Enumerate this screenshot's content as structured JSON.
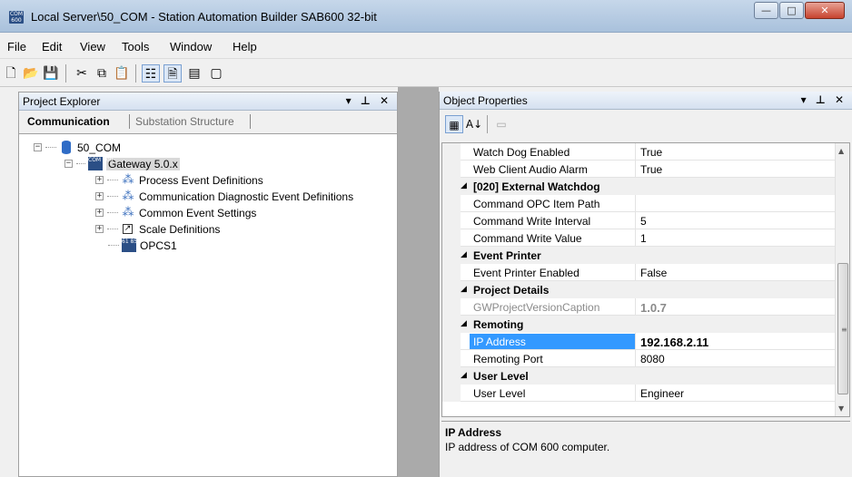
{
  "window": {
    "app_icon_text": "COM 600",
    "title": "Local Server\\50_COM - Station Automation Builder SAB600 32-bit",
    "minimize": "—",
    "maximize": "□",
    "close": "✕"
  },
  "menu": [
    "File",
    "Edit",
    "View",
    "Tools",
    "Window",
    "Help"
  ],
  "toolbar": [
    {
      "icon": "new-file-icon",
      "glyph": "🗋"
    },
    {
      "icon": "open-folder-icon",
      "glyph": "📂"
    },
    {
      "icon": "save-icon",
      "glyph": "💾"
    },
    {
      "icon": "cut-icon",
      "glyph": "✂"
    },
    {
      "icon": "copy-icon",
      "glyph": "⧉"
    },
    {
      "icon": "paste-icon",
      "glyph": "📋"
    },
    {
      "icon": "project-explorer-icon",
      "glyph": "☷"
    },
    {
      "icon": "properties-icon",
      "glyph": "🗎"
    },
    {
      "icon": "output-window-icon",
      "glyph": "▤"
    },
    {
      "icon": "window-icon",
      "glyph": "▢"
    }
  ],
  "project_explorer": {
    "title": "Project Explorer",
    "controls": "▾ ⊥ ✕",
    "tabs": {
      "active": "Communication",
      "inactive": "Substation Structure"
    },
    "tree": {
      "root": {
        "label": "50_COM",
        "expander": "−"
      },
      "gateway": {
        "label": "Gateway 5.0.x",
        "expander": "−",
        "icon_text": "COM 600"
      },
      "children": [
        {
          "label": "Process Event Definitions",
          "expander": "+",
          "icon": "event-definitions-icon"
        },
        {
          "label": "Communication Diagnostic Event Definitions",
          "expander": "+",
          "icon": "event-definitions-icon"
        },
        {
          "label": "Common Event Settings",
          "expander": "+",
          "icon": "event-definitions-icon"
        },
        {
          "label": "Scale Definitions",
          "expander": "+",
          "icon": "scale-icon"
        },
        {
          "label": "OPCS1",
          "expander": "",
          "icon": "opc-server-icon",
          "icon_text": "61 850"
        }
      ]
    }
  },
  "object_properties": {
    "title": "Object Properties",
    "controls": "▾ ⊥ ✕",
    "toolbar": [
      {
        "icon": "categorized-icon",
        "glyph": "▦"
      },
      {
        "icon": "alphabetical-sort-icon",
        "glyph": "A↓"
      },
      {
        "icon": "property-pages-icon",
        "glyph": "▭"
      }
    ],
    "rows": [
      {
        "type": "prop",
        "name": "Watch Dog Enabled",
        "value": "True"
      },
      {
        "type": "prop",
        "name": "Web Client Audio Alarm",
        "value": "True"
      },
      {
        "type": "cat",
        "name": "[020] External Watchdog"
      },
      {
        "type": "prop",
        "name": "Command OPC Item Path",
        "value": ""
      },
      {
        "type": "prop",
        "name": "Command Write Interval",
        "value": "5"
      },
      {
        "type": "prop",
        "name": "Command Write Value",
        "value": "1"
      },
      {
        "type": "cat",
        "name": "Event Printer"
      },
      {
        "type": "prop",
        "name": "Event Printer Enabled",
        "value": "False"
      },
      {
        "type": "cat",
        "name": "Project Details"
      },
      {
        "type": "prop",
        "name": "GWProjectVersionCaption",
        "value": "1.0.7",
        "state": "gray"
      },
      {
        "type": "cat",
        "name": "Remoting"
      },
      {
        "type": "prop",
        "name": "IP Address",
        "value": "192.168.2.11",
        "state": "selected"
      },
      {
        "type": "prop",
        "name": "Remoting Port",
        "value": "8080"
      },
      {
        "type": "cat",
        "name": "User Level"
      },
      {
        "type": "prop",
        "name": "User Level",
        "value": "Engineer"
      }
    ],
    "scroll_glyphs": {
      "up": "▲",
      "down": "▼",
      "grip": "≡"
    },
    "category_glyph": "◢",
    "description": {
      "title": "IP Address",
      "text": "IP address of COM 600 computer."
    }
  }
}
